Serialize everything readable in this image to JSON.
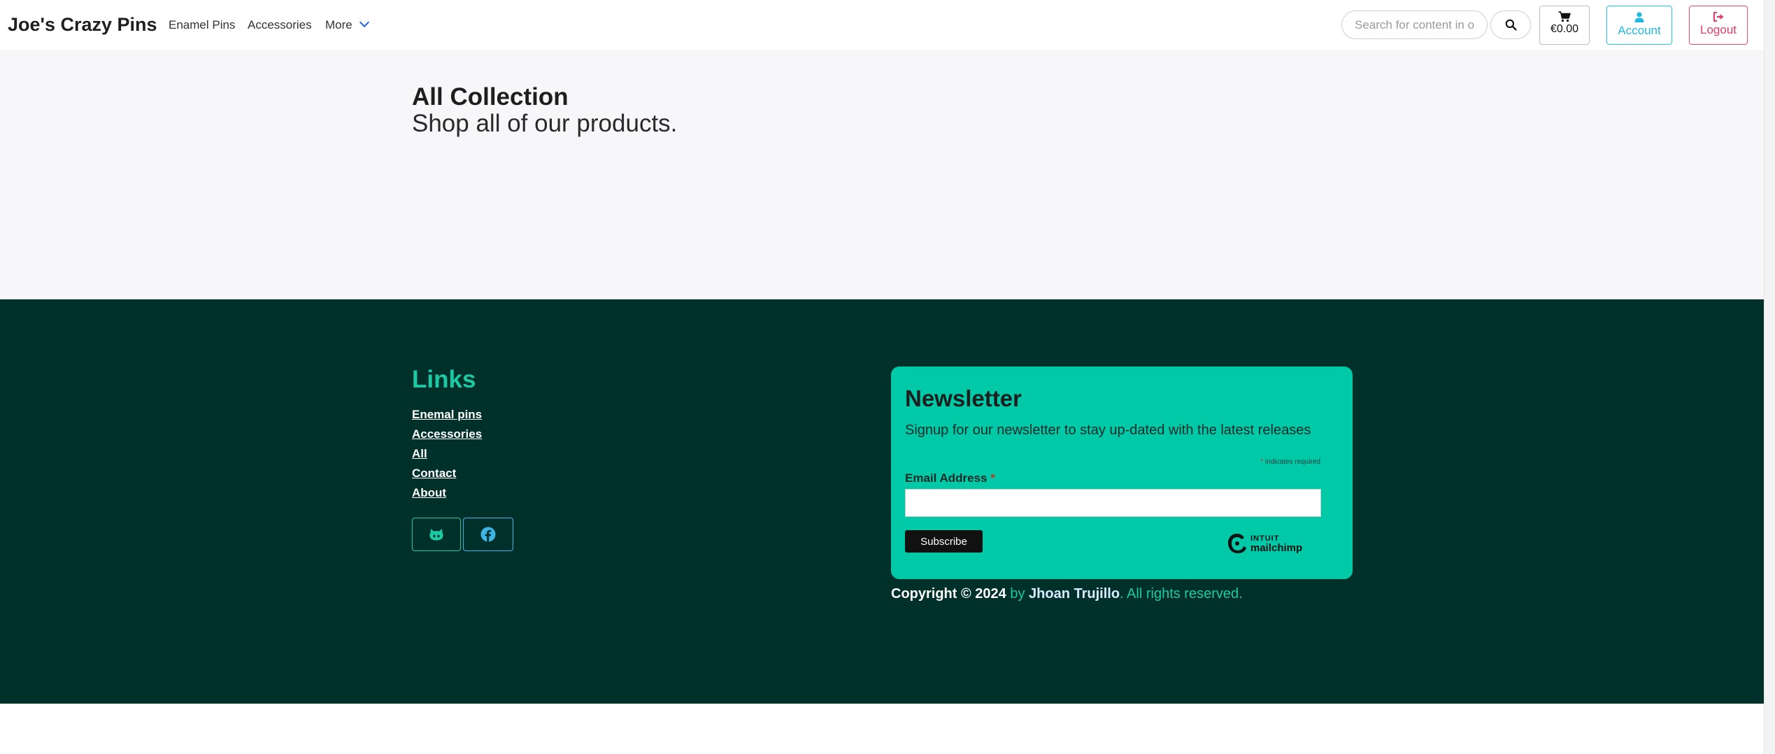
{
  "navbar": {
    "brand": "Joe's Crazy Pins",
    "links": [
      "Enamel Pins",
      "Accessories",
      "More"
    ],
    "search_placeholder": "Search for content in our site",
    "cart_total": "€0.00",
    "account_label": "Account",
    "logout_label": "Logout",
    "icons": {
      "search": "search-icon",
      "cart": "cart-icon",
      "account": "user-icon",
      "logout": "logout-icon",
      "more": "chevron-down-icon"
    }
  },
  "main": {
    "title": "All Collection",
    "subtitle": "Shop all of our products."
  },
  "footer": {
    "links_title": "Links",
    "links": [
      "Enemal pins",
      "Accessories",
      "All",
      "Contact",
      "About"
    ],
    "social": [
      "github-icon",
      "facebook-icon"
    ],
    "newsletter": {
      "title": "Newsletter",
      "text": "Signup for our newsletter to stay up-dated with the latest releases",
      "required_mark": "*",
      "required_note": " indicates required",
      "email_label": "Email Address",
      "email_value": "",
      "submit_label": "Subscribe",
      "badge_line1": "INTUIT",
      "badge_line2": "mailchimp"
    },
    "copyright": {
      "part1": "Copyright © 2024",
      "part2": " by ",
      "author": "Jhoan Trujillo",
      "part4": ". All rights reserved."
    }
  },
  "colors": {
    "footer_bg": "#00302a",
    "accent_teal": "#1cc9a4",
    "newsletter_bg": "#00c9a7",
    "account": "#22b8dd",
    "logout": "#e03d63",
    "more_chevron": "#2563eb"
  }
}
